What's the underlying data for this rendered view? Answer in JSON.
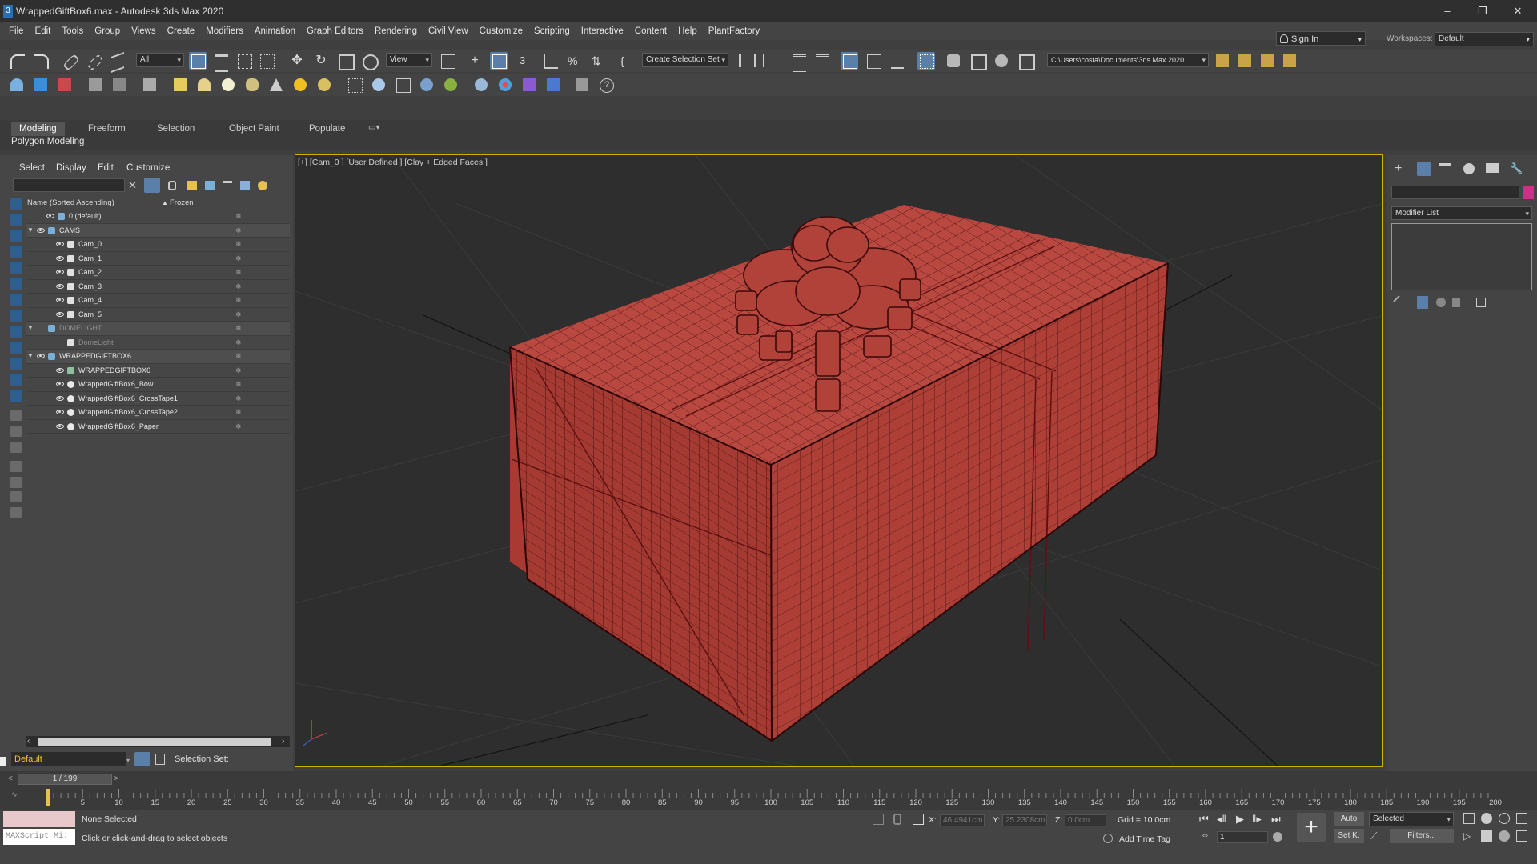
{
  "window": {
    "title": "WrappedGiftBox6.max - Autodesk 3ds Max 2020",
    "app_icon": "3",
    "controls": [
      "minimize-icon",
      "restore-icon",
      "close-icon"
    ]
  },
  "menubar": {
    "items": [
      "File",
      "Edit",
      "Tools",
      "Group",
      "Views",
      "Create",
      "Modifiers",
      "Animation",
      "Graph Editors",
      "Rendering",
      "Civil View",
      "Customize",
      "Scripting",
      "Interactive",
      "Content",
      "Help",
      "PlantFactory"
    ],
    "signin": "Sign In",
    "workspaces_label": "Workspaces:",
    "workspace": "Default"
  },
  "toolbar": {
    "selection_filter": "All",
    "ref_coord": "View",
    "named_selection": "Create Selection Set",
    "project_path": "C:\\Users\\costa\\Documents\\3ds Max 2020"
  },
  "ribbon": {
    "tabs": [
      "Modeling",
      "Freeform",
      "Selection",
      "Object Paint",
      "Populate"
    ],
    "active_tab": "Modeling",
    "panel_label": "Polygon Modeling"
  },
  "scene_explorer": {
    "menu": [
      "Select",
      "Display",
      "Edit",
      "Customize"
    ],
    "column_name": "Name (Sorted Ascending)",
    "column_frozen": "Frozen",
    "rows": [
      {
        "label": "0 (default)",
        "indent": 1,
        "type": "layer",
        "group": false
      },
      {
        "label": "CAMS",
        "indent": 0,
        "type": "layer",
        "group": true
      },
      {
        "label": "Cam_0",
        "indent": 2,
        "type": "camera",
        "group": false
      },
      {
        "label": "Cam_1",
        "indent": 2,
        "type": "camera",
        "group": false
      },
      {
        "label": "Cam_2",
        "indent": 2,
        "type": "camera",
        "group": false
      },
      {
        "label": "Cam_3",
        "indent": 2,
        "type": "camera",
        "group": false
      },
      {
        "label": "Cam_4",
        "indent": 2,
        "type": "camera",
        "group": false
      },
      {
        "label": "Cam_5",
        "indent": 2,
        "type": "camera",
        "group": false
      },
      {
        "label": "DOMELIGHT",
        "indent": 0,
        "type": "layer",
        "group": true,
        "dim": true
      },
      {
        "label": "DomeLight",
        "indent": 2,
        "type": "light",
        "group": false,
        "dim": true
      },
      {
        "label": "WRAPPEDGIFTBOX6",
        "indent": 0,
        "type": "layer",
        "group": true
      },
      {
        "label": "WRAPPEDGIFTBOX6",
        "indent": 2,
        "type": "helper",
        "group": false
      },
      {
        "label": "WrappedGiftBox6_Bow",
        "indent": 2,
        "type": "geometry",
        "group": false
      },
      {
        "label": "WrappedGiftBox6_CrossTape1",
        "indent": 2,
        "type": "geometry",
        "group": false
      },
      {
        "label": "WrappedGiftBox6_CrossTape2",
        "indent": 2,
        "type": "geometry",
        "group": false
      },
      {
        "label": "WrappedGiftBox6_Paper",
        "indent": 2,
        "type": "geometry",
        "group": false
      }
    ],
    "layer": "Default",
    "selection_set_label": "Selection Set:"
  },
  "viewport": {
    "label": "[+] [Cam_0 ] [User Defined ] [Clay + Edged Faces ]",
    "object_color": "#b5453c",
    "border_color": "#c9b300"
  },
  "command_panel": {
    "tabs": [
      "create-icon",
      "modify-icon",
      "hierarchy-icon",
      "motion-icon",
      "display-icon",
      "utilities-icon"
    ],
    "object_color": "#d12f86",
    "modifier_list": "Modifier List"
  },
  "timeline": {
    "frame_display": "1 / 199",
    "ticks": [
      0,
      5,
      10,
      15,
      20,
      25,
      30,
      35,
      40,
      45,
      50,
      55,
      60,
      65,
      70,
      75,
      80,
      85,
      90,
      95,
      100,
      105,
      110,
      115,
      120,
      125,
      130,
      135,
      140,
      145,
      150,
      155,
      160,
      165,
      170,
      175,
      180,
      185,
      190,
      195,
      200
    ]
  },
  "status": {
    "maxscript": "MAXScript Mi:",
    "selection": "None Selected",
    "prompt": "Click or click-and-drag to select objects",
    "x_label": "X:",
    "x_value": "46.4941cm",
    "y_label": "Y:",
    "y_value": "25.2308cm",
    "z_label": "Z:",
    "z_value": "0.0cm",
    "grid": "Grid = 10.0cm",
    "add_time_tag": "Add Time Tag",
    "auto_key": "Auto",
    "set_key": "Set K.",
    "key_filter": "Selected",
    "filters": "Filters...",
    "current_frame": "1"
  }
}
